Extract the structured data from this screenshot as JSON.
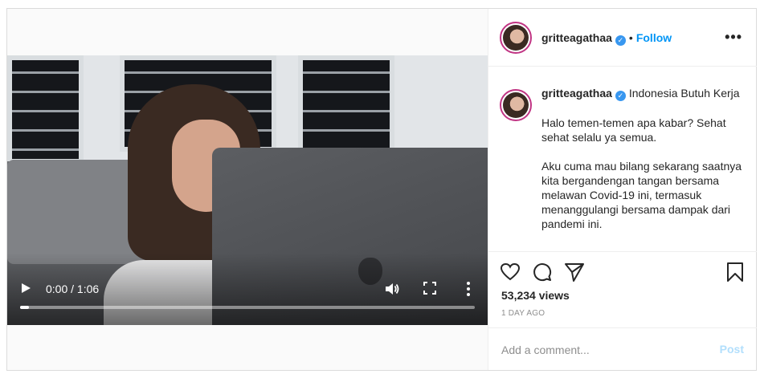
{
  "video": {
    "time": "0:00 / 1:06",
    "progress_fraction": 0.02,
    "play_icon": "play-icon",
    "volume_icon": "volume-icon",
    "fullscreen_icon": "fullscreen-icon",
    "menu_icon": "kebab-menu-icon"
  },
  "header": {
    "username": "gritteagathaa",
    "separator": "•",
    "follow_label": "Follow",
    "more_label": "•••"
  },
  "caption": {
    "username": "gritteagathaa",
    "location": "Indonesia Butuh Kerja",
    "paragraphs": [
      "Halo temen-temen apa kabar? Sehat sehat selalu ya semua.",
      "Aku cuma mau bilang sekarang saatnya kita bergandengan tangan bersama melawan Covid-19 ini, termasuk menanggulangi bersama dampak dari pandemi ini."
    ]
  },
  "actions": {
    "views": "53,234 views",
    "posted_ago": "1 DAY AGO"
  },
  "comment": {
    "placeholder": "Add a comment...",
    "post_label": "Post"
  },
  "colors": {
    "accent": "#0095f6",
    "verified": "#3897f0",
    "post_disabled": "#b2dffc"
  }
}
